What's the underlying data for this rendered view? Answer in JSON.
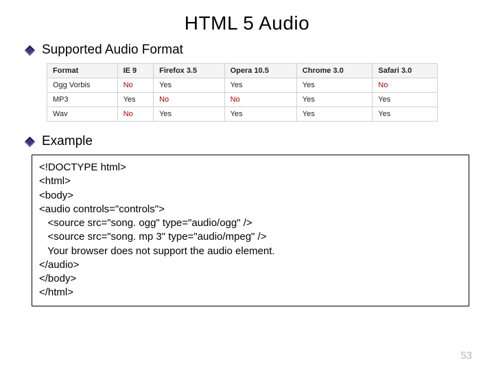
{
  "title": "HTML 5 Audio",
  "sections": {
    "supported": "Supported Audio Format",
    "example": "Example"
  },
  "table": {
    "headers": [
      "Format",
      "IE 9",
      "Firefox 3.5",
      "Opera 10.5",
      "Chrome 3.0",
      "Safari 3.0"
    ],
    "rows": [
      {
        "cells": [
          "Ogg Vorbis",
          "No",
          "Yes",
          "Yes",
          "Yes",
          "No"
        ],
        "noFlags": [
          false,
          true,
          false,
          false,
          false,
          true
        ]
      },
      {
        "cells": [
          "MP3",
          "Yes",
          "No",
          "No",
          "Yes",
          "Yes"
        ],
        "noFlags": [
          false,
          false,
          true,
          true,
          false,
          false
        ]
      },
      {
        "cells": [
          "Wav",
          "No",
          "Yes",
          "Yes",
          "Yes",
          "Yes"
        ],
        "noFlags": [
          false,
          true,
          false,
          false,
          false,
          false
        ]
      }
    ]
  },
  "code": "<!DOCTYPE html>\n<html>\n<body>\n<audio controls=\"controls\">\n   <source src=\"song. ogg\" type=\"audio/ogg\" />\n   <source src=\"song. mp 3\" type=\"audio/mpeg\" />\n   Your browser does not support the audio element.\n</audio>\n</body>\n</html>",
  "pageNumber": "53"
}
